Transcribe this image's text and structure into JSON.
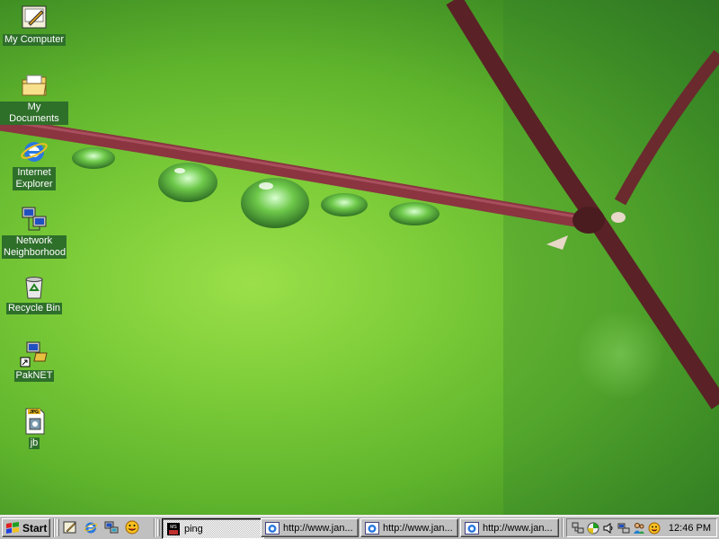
{
  "desktop": {
    "icons": [
      {
        "label": "My Computer",
        "icon": "my-computer-icon"
      },
      {
        "label": "My Documents",
        "icon": "my-documents-icon"
      },
      {
        "label": "Internet Explorer",
        "icon": "internet-explorer-icon"
      },
      {
        "label": "Network Neighborhood",
        "icon": "network-neighborhood-icon"
      },
      {
        "label": "Recycle Bin",
        "icon": "recycle-bin-icon"
      },
      {
        "label": "PakNET",
        "icon": "paknet-shortcut-icon"
      },
      {
        "label": "jb",
        "icon": "jpg-file-icon"
      }
    ],
    "jpg_badge": "JPG"
  },
  "taskbar": {
    "start_label": "Start",
    "quick_launch": [
      "show-desktop-icon",
      "internet-explorer-icon",
      "channels-icon",
      "messenger-smiley-icon"
    ],
    "tasks": [
      {
        "label": "ping",
        "icon": "ms-dos-prompt-icon",
        "active": true
      },
      {
        "label": "http://www.jan...",
        "icon": "internet-explorer-icon",
        "active": false
      },
      {
        "label": "http://www.jan...",
        "icon": "internet-explorer-icon",
        "active": false
      },
      {
        "label": "http://www.jan...",
        "icon": "internet-explorer-icon",
        "active": false
      }
    ],
    "tray_icons": [
      "network-adapter-icon",
      "display-settings-icon",
      "volume-icon",
      "dialup-connection-icon",
      "users-icon",
      "messenger-smiley-icon"
    ],
    "clock": "12:46 PM"
  },
  "colors": {
    "wallpaper_green": "#7fce3a",
    "branch": "#7a2a2e",
    "taskbar_gray": "#c0c0c0",
    "label_bg": "#2e6f2a"
  }
}
